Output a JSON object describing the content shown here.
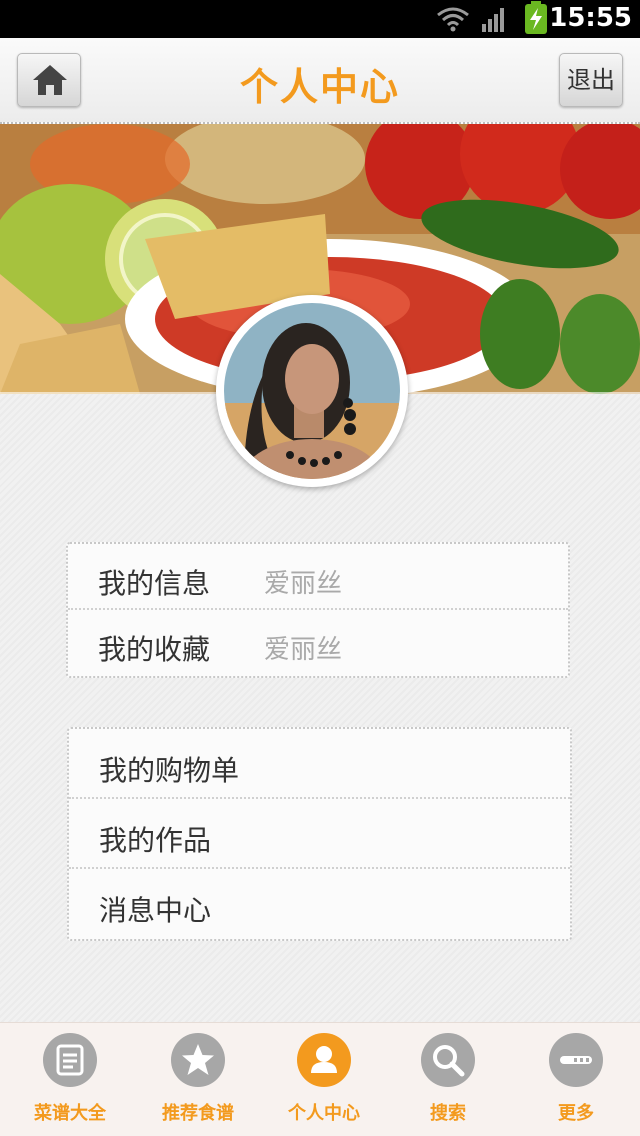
{
  "status_bar": {
    "time": "15:55"
  },
  "header": {
    "title": "个人中心",
    "exit_label": "退出"
  },
  "profile_rows": [
    {
      "label": "我的信息",
      "value": "爱丽丝"
    },
    {
      "label": "我的收藏",
      "value": "爱丽丝"
    }
  ],
  "menu_rows": [
    {
      "label": "我的购物单"
    },
    {
      "label": "我的作品"
    },
    {
      "label": "消息中心"
    }
  ],
  "tabs": [
    {
      "label": "菜谱大全",
      "icon": "book-icon"
    },
    {
      "label": "推荐食谱",
      "icon": "star-icon"
    },
    {
      "label": "个人中心",
      "icon": "user-icon",
      "active": true
    },
    {
      "label": "搜索",
      "icon": "search-icon"
    },
    {
      "label": "更多",
      "icon": "more-icon"
    }
  ],
  "colors": {
    "accent": "#f39a1e",
    "inactive_icon": "#a7a7a7",
    "battery": "#6ab821"
  }
}
